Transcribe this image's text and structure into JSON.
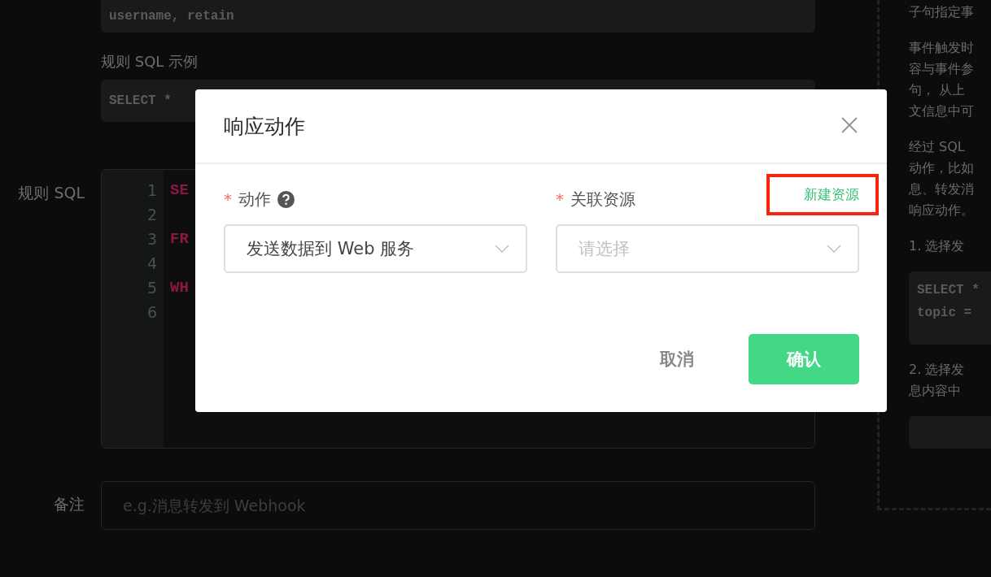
{
  "form": {
    "fields_code": "username, retain",
    "example_label": "规则 SQL 示例",
    "example_code": "SELECT *",
    "sql_label": "规则 SQL",
    "sql_lines": [
      {
        "number": "1",
        "code": "SE"
      },
      {
        "number": "2"
      },
      {
        "number": "3",
        "code": "FR"
      },
      {
        "number": "4"
      },
      {
        "number": "5",
        "code": "WH"
      },
      {
        "number": "6"
      }
    ],
    "note_label": "备注",
    "note_placeholder": "e.g.消息转发到 Webhook"
  },
  "help_panel": [
    {
      "kind": "text",
      "lines": [
        "子句指定事"
      ]
    },
    {
      "kind": "text",
      "lines": [
        "事件触发时",
        "容与事件参",
        "句， 从上",
        "文信息中可"
      ]
    },
    {
      "kind": "text",
      "lines": [
        "经过 SQL",
        "动作，比如",
        "息、转发消",
        "响应动作。"
      ]
    },
    {
      "kind": "text",
      "lines": [
        "1. 选择发"
      ]
    },
    {
      "kind": "code",
      "lines": [
        "SELECT *",
        "topic ="
      ]
    },
    {
      "kind": "text",
      "lines": [
        "2. 选择发",
        "息内容中"
      ]
    },
    {
      "kind": "code"
    }
  ],
  "dialog": {
    "title": "响应动作",
    "fields": [
      {
        "label": "动作",
        "required_mark": "*",
        "help": true,
        "value": "发送数据到 Web 服务"
      },
      {
        "label": "关联资源",
        "required_mark": "*",
        "placeholder": "请选择",
        "link": "新建资源",
        "link_highlighted": true
      }
    ],
    "buttons": [
      {
        "label": "取消",
        "primary": false
      },
      {
        "label": "确认",
        "primary": true
      }
    ]
  }
}
